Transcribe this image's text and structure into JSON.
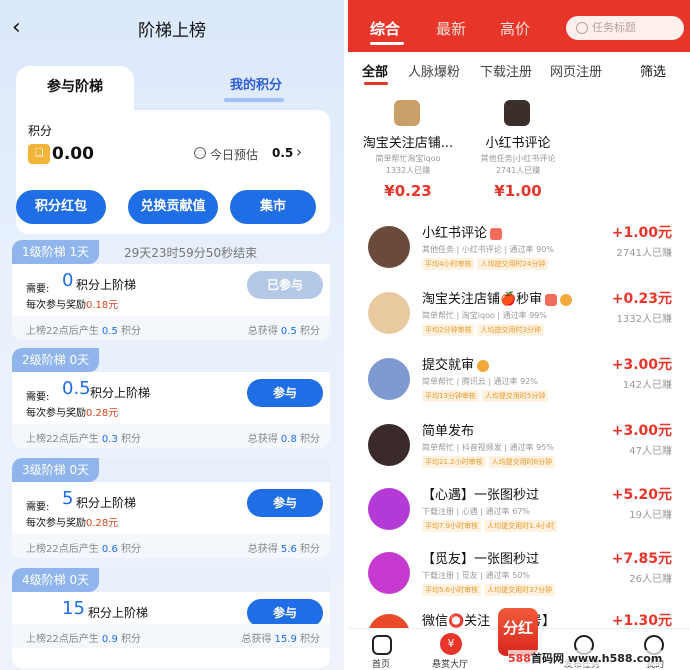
{
  "left": {
    "title": "阶梯上榜",
    "back_icon": "‹",
    "tab_active": "参与阶梯",
    "tab_other": "我的积分",
    "points_label": "积分",
    "points_icon_glyph": "❏",
    "points_value": "0.00",
    "today_label": "今日预估",
    "today_value": "0.5",
    "buttons": [
      "积分红包",
      "兑换贡献值",
      "集市"
    ],
    "levels": [
      {
        "tag": "1级阶梯 1天",
        "end": "29天23时59分50秒结束",
        "need_label": "需要:",
        "need_value": "0",
        "need_unit": "积分上阶梯",
        "reward_label": "每次参与奖励",
        "reward_value": "0.18元",
        "action": "已参与",
        "done": true,
        "foot_left": "上榜22点后产生",
        "foot_left_v": "0.5",
        "foot_left_u": "积分",
        "foot_right": "总获得",
        "foot_right_v": "0.5",
        "foot_right_u": "积分"
      },
      {
        "tag": "2级阶梯 0天",
        "end": "",
        "need_label": "需要:",
        "need_value": "0.5",
        "need_unit": "积分上阶梯",
        "reward_label": "每次参与奖励",
        "reward_value": "0.28元",
        "action": "参与",
        "done": false,
        "foot_left": "上榜22点后产生",
        "foot_left_v": "0.3",
        "foot_left_u": "积分",
        "foot_right": "总获得",
        "foot_right_v": "0.8",
        "foot_right_u": "积分"
      },
      {
        "tag": "3级阶梯 0天",
        "end": "",
        "need_label": "需要:",
        "need_value": "5",
        "need_unit": "积分上阶梯",
        "reward_label": "每次参与奖励",
        "reward_value": "0.28元",
        "action": "参与",
        "done": false,
        "foot_left": "上榜22点后产生",
        "foot_left_v": "0.6",
        "foot_left_u": "积分",
        "foot_right": "总获得",
        "foot_right_v": "5.6",
        "foot_right_u": "积分"
      },
      {
        "tag": "4级阶梯 0天",
        "end": "",
        "need_label": "需要:",
        "need_value": "15",
        "need_unit": "积分上阶梯",
        "reward_label": "",
        "reward_value": "",
        "action": "参与",
        "done": false,
        "foot_left": "上榜22点后产生",
        "foot_left_v": "0.9",
        "foot_left_u": "积分",
        "foot_right": "总获得",
        "foot_right_v": "15.9",
        "foot_right_u": "积分"
      }
    ]
  },
  "right": {
    "tabs": [
      "综合",
      "最新",
      "高价"
    ],
    "search_placeholder": "任务标题",
    "subtabs": [
      "全部",
      "人脉爆粉",
      "下载注册",
      "网页注册"
    ],
    "filter": "筛选",
    "featured": [
      {
        "title": "淘宝关注店铺...",
        "sub": "简单帮忙淘宝iqoo",
        "done": "1332人已赚",
        "price": "¥0.23"
      },
      {
        "title": "小红书评论",
        "sub": "其他任务|小红书评论",
        "done": "2741人已赚",
        "price": "¥1.00"
      }
    ],
    "items": [
      {
        "title": "小红书评论",
        "sub": "其他任务 | 小红书评论 | 通过率 90%",
        "tags": [
          "平均4小时审核",
          "人均提交用时24分钟"
        ],
        "price": "+1.00元",
        "done": "2741人已赚",
        "img": "#6a4a3a"
      },
      {
        "title": "淘宝关注店铺🍎秒审",
        "sub": "简单帮忙 | 淘宝iqoo | 通过率 99%",
        "tags": [
          "平均2分钟审核",
          "人均提交用时3分钟"
        ],
        "price": "+0.23元",
        "done": "1332人已赚",
        "img": "#e8c9a0"
      },
      {
        "title": "提交就审",
        "sub": "简单帮忙 | 腾讯云 | 通过率 92%",
        "tags": [
          "平均13分钟审核",
          "人均提交用时5分钟"
        ],
        "price": "+3.00元",
        "done": "142人已赚",
        "img": "#7f9ad0"
      },
      {
        "title": "简单发布",
        "sub": "简单帮忙 | 抖音视频发 | 通过率 95%",
        "tags": [
          "平均21.2小时审核",
          "人均提交用时6分钟"
        ],
        "price": "+3.00元",
        "done": "47人已赚",
        "img": "#3a2a2a"
      },
      {
        "title": "【心遇】一张图秒过",
        "sub": "下载注册 | 心遇 | 通过率 67%",
        "tags": [
          "平均7.9小时审核",
          "人均提交用时1.4小时"
        ],
        "price": "+5.20元",
        "done": "19人已赚",
        "img": "#b43ad8"
      },
      {
        "title": "【觅友】一张图秒过",
        "sub": "下载注册 | 觅友 | 通过率 50%",
        "tags": [
          "平均5.6小时审核",
          "人均提交用时37分钟"
        ],
        "price": "+7.85元",
        "done": "26人已赚",
        "img": "#c63ad0"
      },
      {
        "title": "微信⭕关注【公众号】",
        "sub": "",
        "tags": [],
        "price": "+1.30元",
        "done": "",
        "img": "#e84a2a"
      }
    ],
    "bottom": [
      "首页",
      "悬赏大厅",
      "分红",
      "发布任务",
      "我的"
    ],
    "watermark_a": "588",
    "watermark_b": "首码网",
    "watermark_c": "www.h588.com"
  }
}
